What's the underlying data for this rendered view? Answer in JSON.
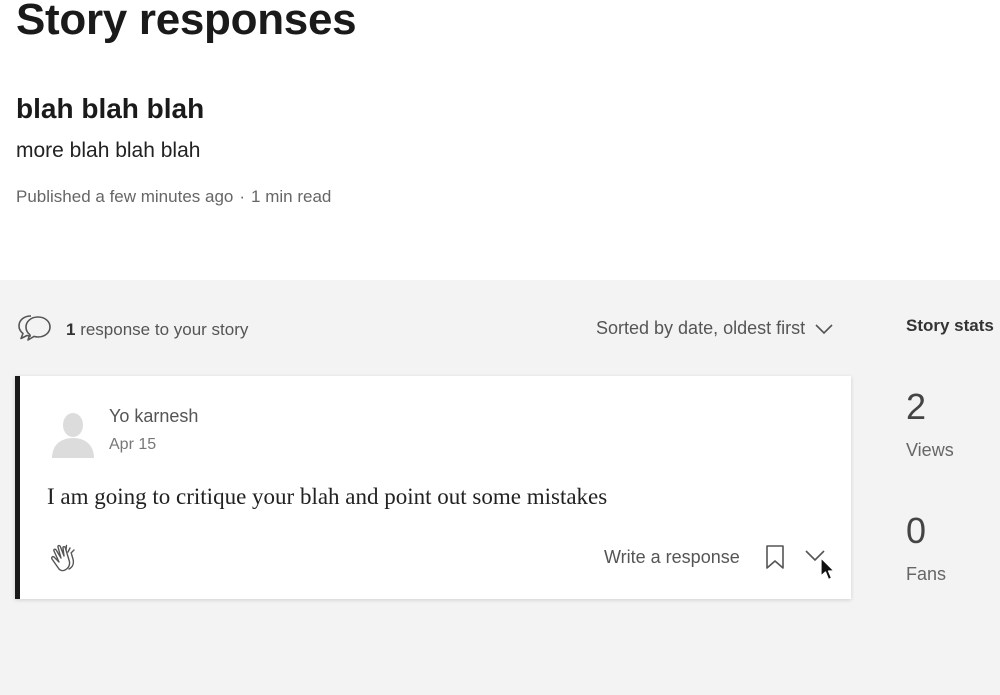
{
  "page": {
    "title": "Story responses"
  },
  "story": {
    "title": "blah blah blah",
    "subtitle": "more blah blah blah",
    "published": "Published a few minutes ago",
    "separator": "·",
    "read_time": "1 min read"
  },
  "responses_header": {
    "count": "1",
    "label": " response to your story",
    "icon": "speech-bubbles-icon"
  },
  "sort": {
    "label": "Sorted by date, oldest first",
    "icon": "chevron-down-icon"
  },
  "stats": {
    "title": "Story stats",
    "views": {
      "value": "2",
      "label": "Views"
    },
    "fans": {
      "value": "0",
      "label": "Fans"
    }
  },
  "response": {
    "author": "Yo karnesh",
    "date": "Apr 15",
    "text": "I am going to critique your blah and point out some mistakes",
    "write_response_label": "Write a response",
    "icons": [
      "clap-icon",
      "bookmark-icon",
      "chevron-down-icon"
    ]
  },
  "colors": {
    "accent_border": "#1a1a1a",
    "panel_bg": "#f3f3f3",
    "muted_text": "#666666"
  }
}
